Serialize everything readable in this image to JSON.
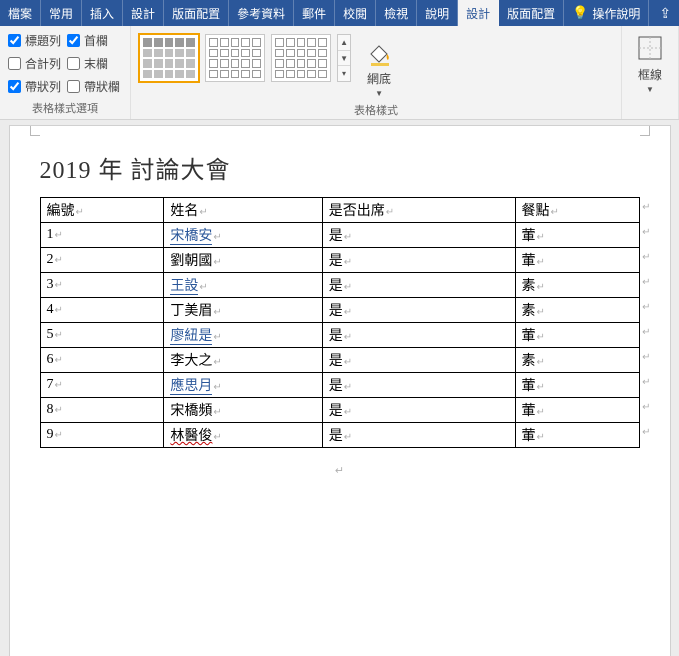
{
  "menu": {
    "tabs": [
      "檔案",
      "常用",
      "插入",
      "設計",
      "版面配置",
      "參考資料",
      "郵件",
      "校閱",
      "檢視",
      "說明",
      "設計",
      "版面配置"
    ],
    "active_index": 10,
    "tell_me": "操作說明"
  },
  "ribbon": {
    "style_options": {
      "header_row": {
        "label": "標題列",
        "checked": true
      },
      "first_col": {
        "label": "首欄",
        "checked": true
      },
      "total_row": {
        "label": "合計列",
        "checked": false
      },
      "last_col": {
        "label": "末欄",
        "checked": false
      },
      "banded_row": {
        "label": "帶狀列",
        "checked": true
      },
      "banded_col": {
        "label": "帶狀欄",
        "checked": false
      },
      "group_label": "表格樣式選項"
    },
    "table_styles_label": "表格樣式",
    "shading_label": "網底",
    "borders_label": "框線"
  },
  "document": {
    "title": "2019 年 討論大會",
    "headers": [
      "編號",
      "姓名",
      "是否出席",
      "餐點"
    ],
    "rows": [
      {
        "n": "1",
        "name": "宋橋安",
        "attend": "是",
        "meal": "葷",
        "u": true
      },
      {
        "n": "2",
        "name": "劉朝國",
        "attend": "是",
        "meal": "葷"
      },
      {
        "n": "3",
        "name": "王設",
        "attend": "是",
        "meal": "素",
        "u": true
      },
      {
        "n": "4",
        "name": "丁美眉",
        "attend": "是",
        "meal": "素"
      },
      {
        "n": "5",
        "name": "廖紐是",
        "attend": "是",
        "meal": "葷",
        "u": true
      },
      {
        "n": "6",
        "name": "李大之",
        "attend": "是",
        "meal": "素"
      },
      {
        "n": "7",
        "name": "應思月",
        "attend": "是",
        "meal": "葷",
        "u": true
      },
      {
        "n": "8",
        "name": "宋橋頻",
        "attend": "是",
        "meal": "葷"
      },
      {
        "n": "9",
        "name": "林醫俊",
        "attend": "是",
        "meal": "葷",
        "wavy": true
      }
    ]
  }
}
